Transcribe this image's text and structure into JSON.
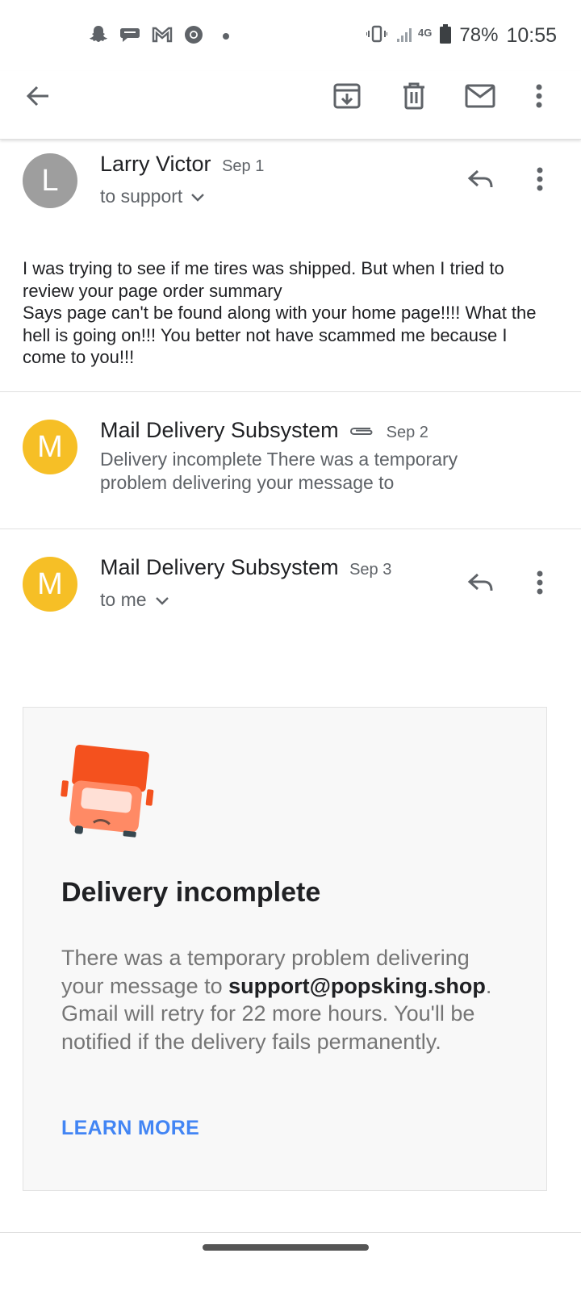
{
  "status_bar": {
    "battery": "78%",
    "time": "10:55",
    "network": "4G",
    "notification_icons": [
      "snapchat-icon",
      "messaging-icon",
      "gmail-icon",
      "chrome-icon"
    ]
  },
  "toolbar": {
    "icons": [
      "back-arrow-icon",
      "archive-icon",
      "delete-icon",
      "mark-unread-icon",
      "more-vert-icon"
    ]
  },
  "messages": [
    {
      "avatar_letter": "L",
      "avatar_color": "#9e9e9e",
      "sender": "Larry Victor",
      "date": "Sep 1",
      "to": "to support",
      "body_lines": [
        "I was trying to see if me tires was shipped. But when I tried to review your page order summary",
        "Says page can't be found along with your home page!!!! What the hell is going on!!! You better not have scammed me because I come to you!!!"
      ]
    },
    {
      "avatar_letter": "M",
      "avatar_color": "#f6bf26",
      "sender": "Mail Delivery Subsystem",
      "date": "Sep 2",
      "has_attachment": true,
      "snippet": "Delivery incomplete There was a temporary problem delivering your message to"
    },
    {
      "avatar_letter": "M",
      "avatar_color": "#f6bf26",
      "sender": "Mail Delivery Subsystem",
      "date": "Sep 3",
      "to": "to me"
    }
  ],
  "card": {
    "title": "Delivery incomplete",
    "text_before": "There was a temporary problem delivering your message to ",
    "email": "support@popsking.shop",
    "text_after": ". Gmail will retry for 22 more hours. You'll be notified if the delivery fails permanently.",
    "link": "LEARN MORE",
    "truck_color": "#f4511e",
    "link_color": "#4285f4"
  }
}
